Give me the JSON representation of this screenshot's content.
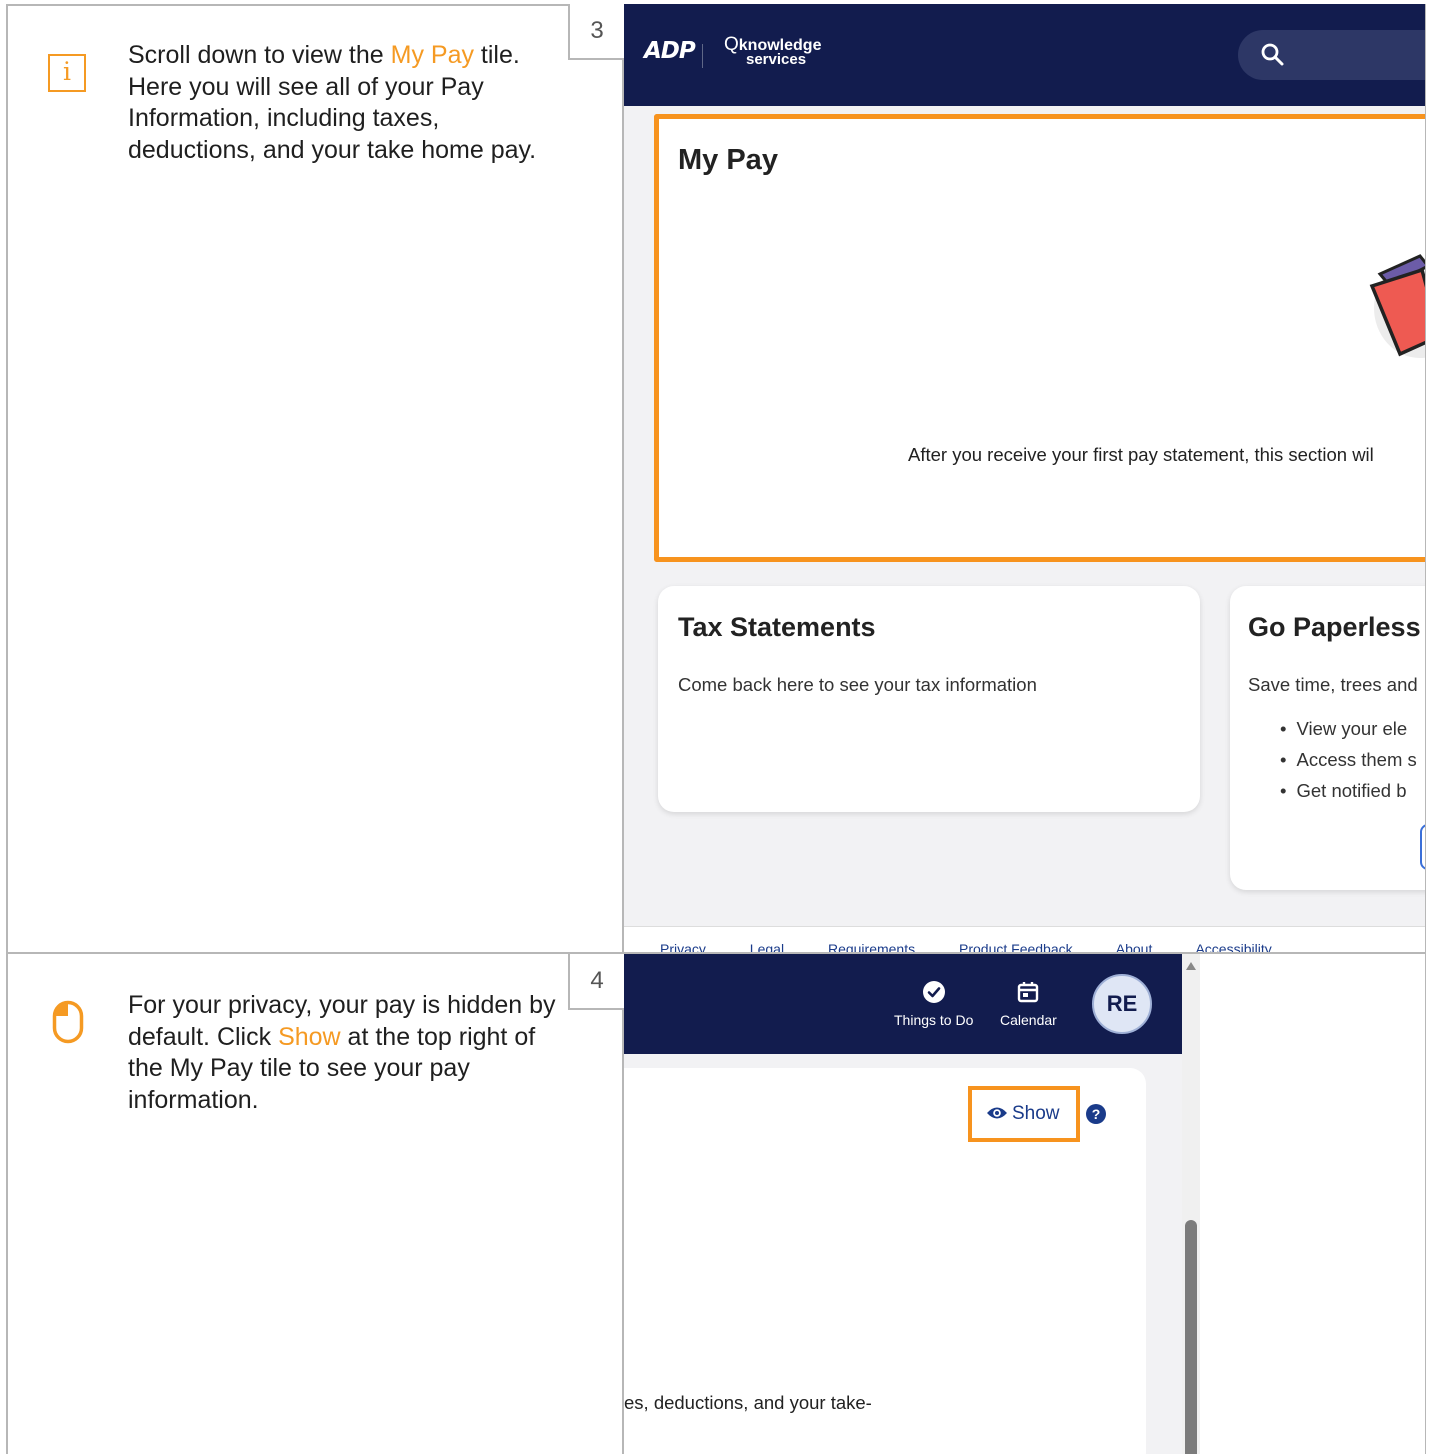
{
  "steps": [
    {
      "number": "3",
      "text_before": "Scroll down to view the ",
      "highlight": "My Pay",
      "text_after": " tile. Here you will see all of your Pay Information, including taxes, deductions, and your take home pay.",
      "icon": "info-icon"
    },
    {
      "number": "4",
      "text_before": "For your privacy, your pay is hidden by default. Click ",
      "highlight": "Show",
      "text_after": " at the top right of the My Pay tile to see your pay information.",
      "icon": "mouse-icon"
    }
  ],
  "highlight_color": "#f59a23",
  "screenshot3": {
    "brand": "ADP",
    "app_name_top": "knowledge",
    "app_name_q": "Q",
    "app_name_bottom": "services",
    "search_icon": "search-icon",
    "my_pay": {
      "title": "My Pay",
      "message": "After you receive your first pay statement, this section wil"
    },
    "tax_statements": {
      "title": "Tax Statements",
      "body": "Come back here to see your tax information"
    },
    "go_paperless": {
      "title": "Go Paperless",
      "body": "Save time, trees and",
      "bullets": [
        "View your ele",
        "Access them s",
        "Get notified b"
      ]
    },
    "footer_links": [
      "Privacy",
      "Legal",
      "Requirements",
      "Product Feedback",
      "About",
      "Accessibility"
    ]
  },
  "screenshot4": {
    "nav": [
      {
        "label": "Things to Do",
        "icon": "check-circle-icon"
      },
      {
        "label": "Calendar",
        "icon": "calendar-icon"
      }
    ],
    "avatar_initials": "RE",
    "show_label": "Show",
    "help_label": "?",
    "body_fragment": "es, deductions, and your take-"
  },
  "colors": {
    "navbar": "#121c4e",
    "orange_highlight": "#f7931e",
    "link_blue": "#1a3b8a"
  }
}
